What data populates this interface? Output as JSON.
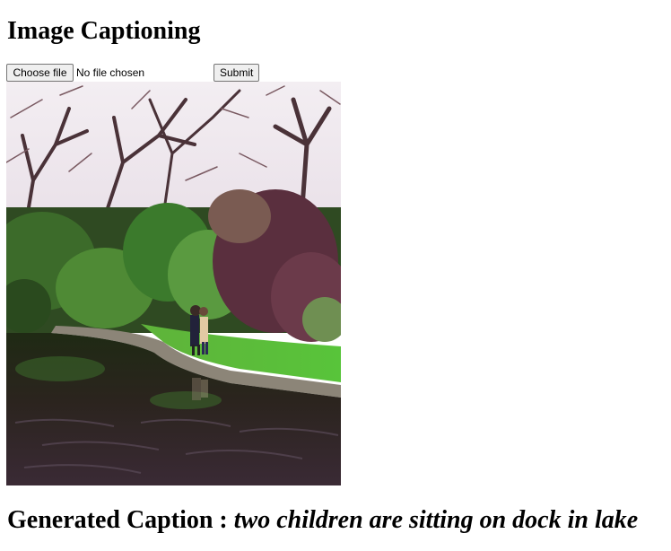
{
  "page": {
    "title": "Image Captioning"
  },
  "form": {
    "choose_file_label": "Choose file",
    "file_status": "No file chosen",
    "submit_label": "Submit"
  },
  "result": {
    "label": "Generated Caption :",
    "caption": "two children are sitting on dock in lake"
  }
}
